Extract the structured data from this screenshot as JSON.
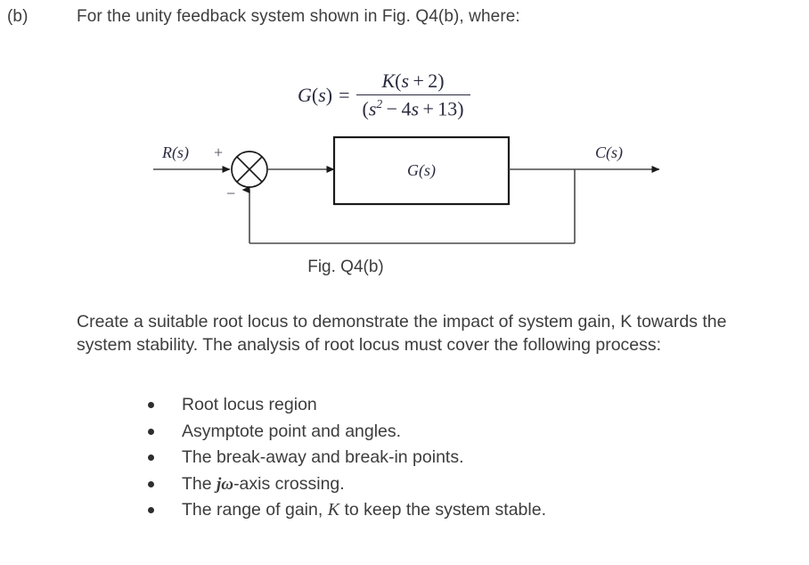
{
  "question": {
    "label": "(b)",
    "intro": "For the unity feedback system shown in Fig. Q4(b), where:"
  },
  "equation": {
    "lhs": "G(s)",
    "equals": "=",
    "numerator": "K(s + 2)",
    "denominator": "(s² − 4s + 13)",
    "numerator_parts": {
      "gain": "K",
      "open_paren": "(",
      "s": "s",
      "plus": "+",
      "zero_value": "2",
      "close_paren": ")"
    },
    "denominator_parts": {
      "open_paren": "(",
      "s": "s",
      "power": "2",
      "minus": "−",
      "coef": "4",
      "s2": "s",
      "plus": "+",
      "constant": "13",
      "close_paren": ")"
    }
  },
  "diagram": {
    "input_label": "R(s)",
    "output_label": "C(s)",
    "block_label": "G(s)",
    "plus_sign": "+",
    "minus_sign": "−",
    "caption": "Fig. Q4(b)",
    "line_color": "#4a4a4a",
    "block_border_color": "#1a1a1a"
  },
  "body": {
    "paragraph_pre": "Create a suitable root locus to demonstrate the impact of system gain, ",
    "paragraph_k": "K",
    "paragraph_post": " towards the system stability. The analysis of root locus must cover the following process:"
  },
  "bullets": [
    {
      "text": "Root locus region",
      "pre": "Root locus region",
      "italic": "",
      "post": ""
    },
    {
      "text": "Asymptote point and angles.",
      "pre": "Asymptote point and angles.",
      "italic": "",
      "post": ""
    },
    {
      "text": "The break-away and break-in points.",
      "pre": "The break-away and break-in points.",
      "italic": "",
      "post": ""
    },
    {
      "text": "The jω-axis crossing.",
      "pre": "The ",
      "italic": "jω",
      "post": "-axis crossing."
    },
    {
      "text": "The range of gain, K to keep the system stable.",
      "pre": "The range of gain, ",
      "italic": "K",
      "post": " to keep the system stable."
    }
  ]
}
